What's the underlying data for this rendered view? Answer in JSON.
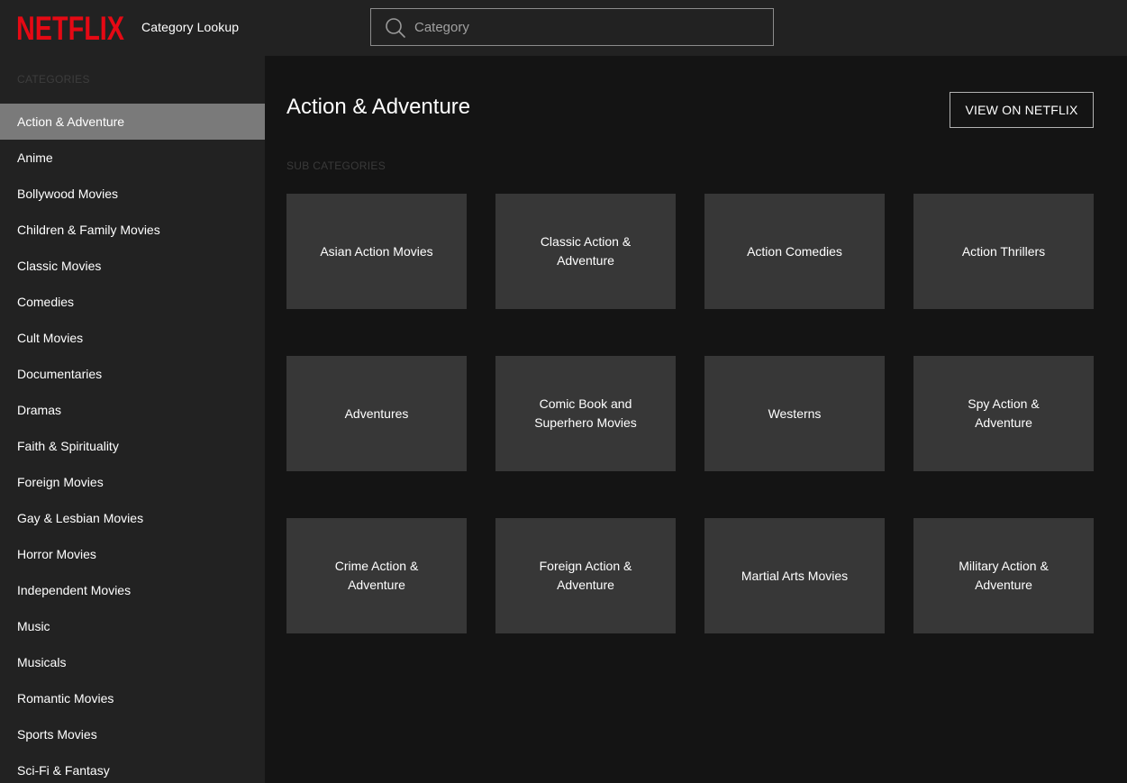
{
  "header": {
    "brand": "NETFLIX",
    "app_title": "Category Lookup",
    "search": {
      "placeholder": "Category",
      "value": ""
    }
  },
  "colors": {
    "brand_red": "#e50914",
    "active_item": "#7a7a7a",
    "tile_bg": "#373737"
  },
  "sidebar": {
    "heading": "CATEGORIES",
    "active_index": 0,
    "items": [
      {
        "label": "Action & Adventure"
      },
      {
        "label": "Anime"
      },
      {
        "label": "Bollywood Movies"
      },
      {
        "label": "Children & Family Movies"
      },
      {
        "label": "Classic Movies"
      },
      {
        "label": "Comedies"
      },
      {
        "label": "Cult Movies"
      },
      {
        "label": "Documentaries"
      },
      {
        "label": "Dramas"
      },
      {
        "label": "Faith & Spirituality"
      },
      {
        "label": "Foreign Movies"
      },
      {
        "label": "Gay & Lesbian Movies"
      },
      {
        "label": "Horror Movies"
      },
      {
        "label": "Independent Movies"
      },
      {
        "label": "Music"
      },
      {
        "label": "Musicals"
      },
      {
        "label": "Romantic Movies"
      },
      {
        "label": "Sports Movies"
      },
      {
        "label": "Sci-Fi & Fantasy"
      }
    ]
  },
  "main": {
    "title": "Action & Adventure",
    "view_button": "VIEW ON NETFLIX",
    "sub_heading": "SUB CATEGORIES",
    "subcategories": [
      {
        "label": "Asian Action Movies"
      },
      {
        "label": "Classic Action & Adventure"
      },
      {
        "label": "Action Comedies"
      },
      {
        "label": "Action Thrillers"
      },
      {
        "label": "Adventures"
      },
      {
        "label": "Comic Book and Superhero Movies"
      },
      {
        "label": "Westerns"
      },
      {
        "label": "Spy Action & Adventure"
      },
      {
        "label": "Crime Action & Adventure"
      },
      {
        "label": "Foreign Action & Adventure"
      },
      {
        "label": "Martial Arts Movies"
      },
      {
        "label": "Military Action & Adventure"
      }
    ]
  }
}
